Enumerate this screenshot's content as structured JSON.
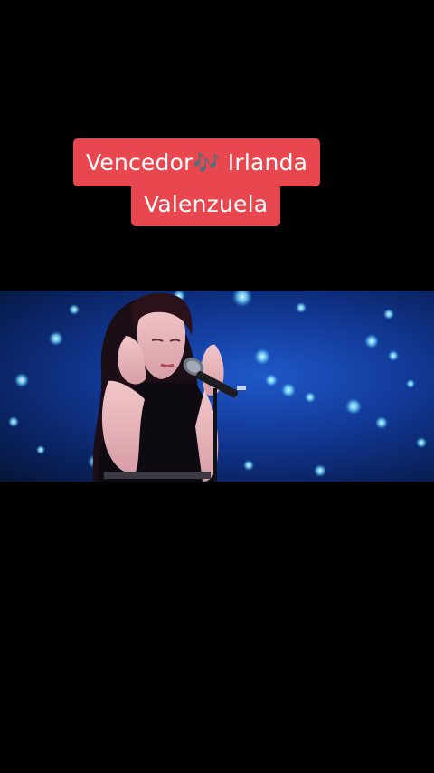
{
  "caption": {
    "line1_text_before_icon": "Vencedor",
    "line1_icon": "musical-notes-icon",
    "line1_text_after_icon": " Irlanda",
    "line2_text": "Valenzuela",
    "background_color": "#e8474f",
    "text_color": "#ffffff"
  },
  "video": {
    "description_icon": "singer-with-microphone",
    "background_color": "#1a4bb8"
  }
}
